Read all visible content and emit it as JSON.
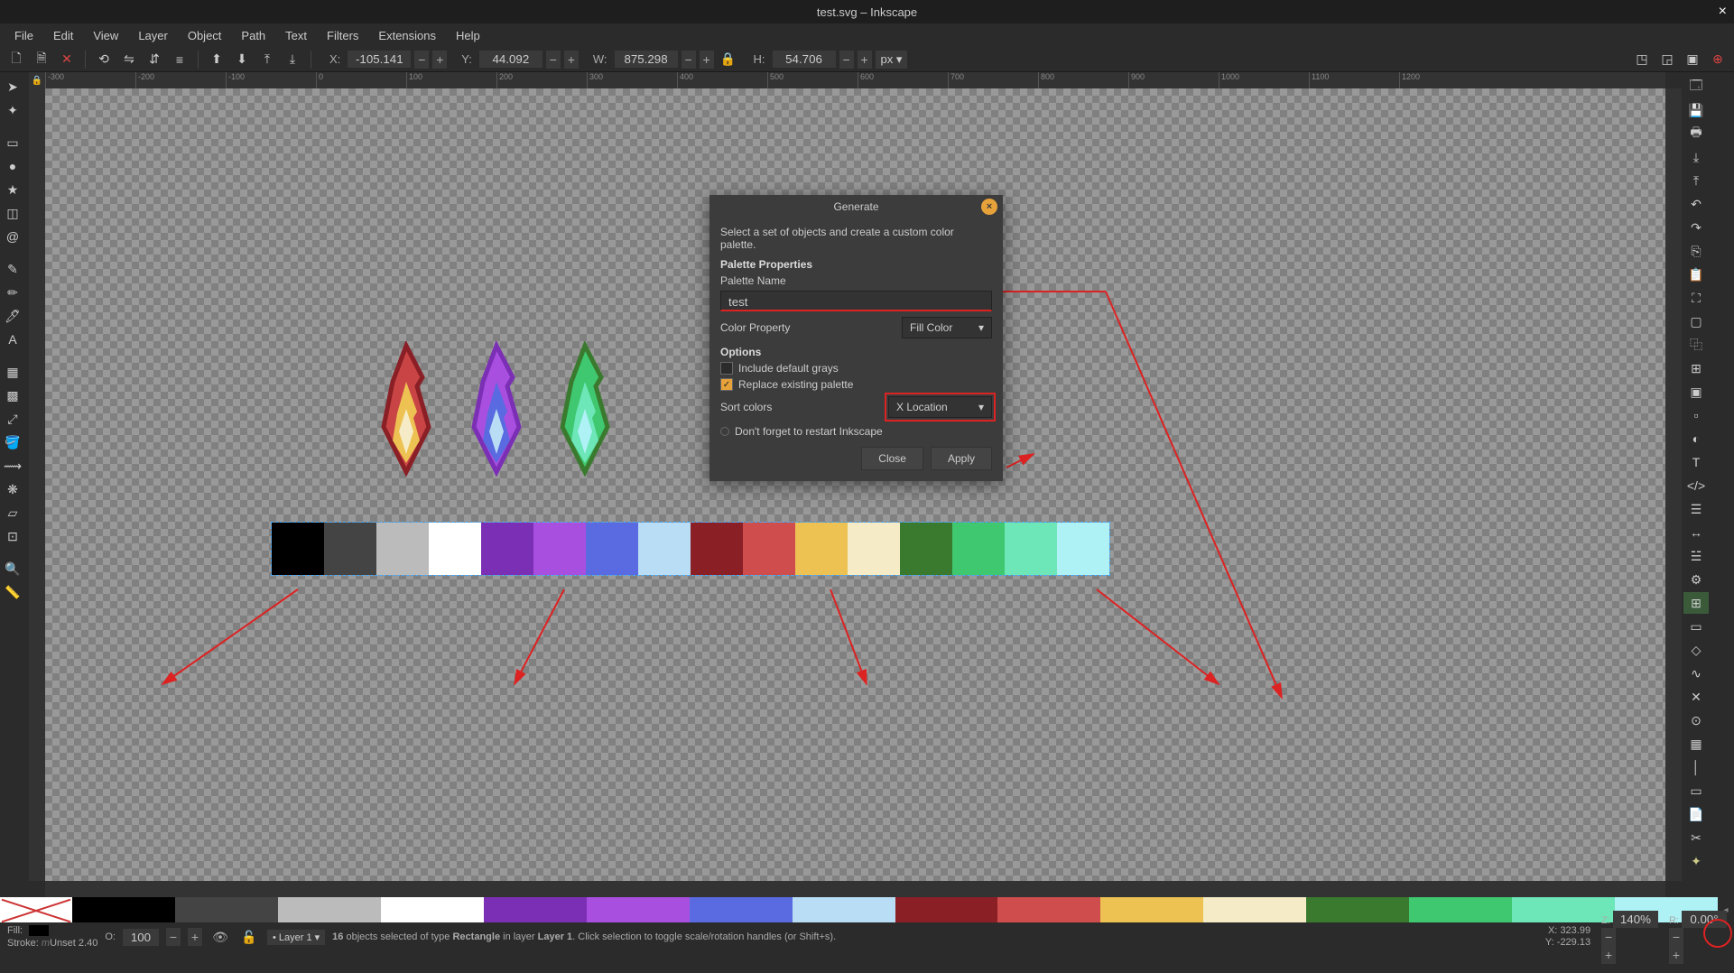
{
  "window": {
    "title": "test.svg – Inkscape"
  },
  "menus": [
    "File",
    "Edit",
    "View",
    "Layer",
    "Object",
    "Path",
    "Text",
    "Filters",
    "Extensions",
    "Help"
  ],
  "coords": {
    "x_label": "X:",
    "x": "-105.141",
    "y_label": "Y:",
    "y": "44.092",
    "w_label": "W:",
    "w": "875.298",
    "h_label": "H:",
    "h": "54.706",
    "units": "px"
  },
  "dialog": {
    "title": "Generate",
    "desc": "Select a set of objects and create a custom color palette.",
    "sect_palette": "Palette Properties",
    "name_label": "Palette Name",
    "name_value": "test",
    "color_prop_label": "Color Property",
    "color_prop_value": "Fill Color",
    "sect_options": "Options",
    "cb_grays": "Include default grays",
    "cb_replace": "Replace existing palette",
    "sort_label": "Sort colors",
    "sort_value": "X Location",
    "restart_note": "Don't forget to restart Inkscape",
    "close": "Close",
    "apply": "Apply"
  },
  "swatches": [
    "#000000",
    "#444444",
    "#bbbbbb",
    "#ffffff",
    "#7b2fb5",
    "#a94fe0",
    "#5a6ae0",
    "#b8ddf5",
    "#8a1f26",
    "#cf4d4d",
    "#edc252",
    "#f5ecc7",
    "#3a7a2e",
    "#3fc86f",
    "#6de6b8",
    "#aef2f5"
  ],
  "palette": [
    "#000000",
    "#444444",
    "#bbbbbb",
    "#ffffff",
    "#7b2fb5",
    "#a94fe0",
    "#5a6ae0",
    "#b8ddf5",
    "#8a1f26",
    "#cf4d4d",
    "#edc252",
    "#f5ecc7",
    "#3a7a2e",
    "#3fc86f",
    "#6de6b8",
    "#aef2f5"
  ],
  "status": {
    "fill_label": "Fill:",
    "stroke_label": "Stroke:",
    "stroke_value": "Unset",
    "stroke_width": "2.40",
    "opacity_label": "O:",
    "opacity": "100",
    "layer": "Layer 1",
    "selection": "16 objects selected of type Rectangle in layer Layer 1. Click selection to toggle scale/rotation handles (or Shift+s).",
    "sel_count": "16",
    "sel_type": "Rectangle",
    "sel_layer": "Layer 1",
    "cursor_x_label": "X:",
    "cursor_x": "323.99",
    "cursor_y_label": "Y:",
    "cursor_y": "-229.13",
    "zoom_label": "Z:",
    "zoom": "140%",
    "rotation_label": "R:",
    "rotation": "0.00°"
  },
  "ruler_marks": [
    "-300",
    "-200",
    "-100",
    "0",
    "100",
    "200",
    "300",
    "400",
    "500",
    "600",
    "700",
    "800",
    "900",
    "1000",
    "1100",
    "1200"
  ]
}
